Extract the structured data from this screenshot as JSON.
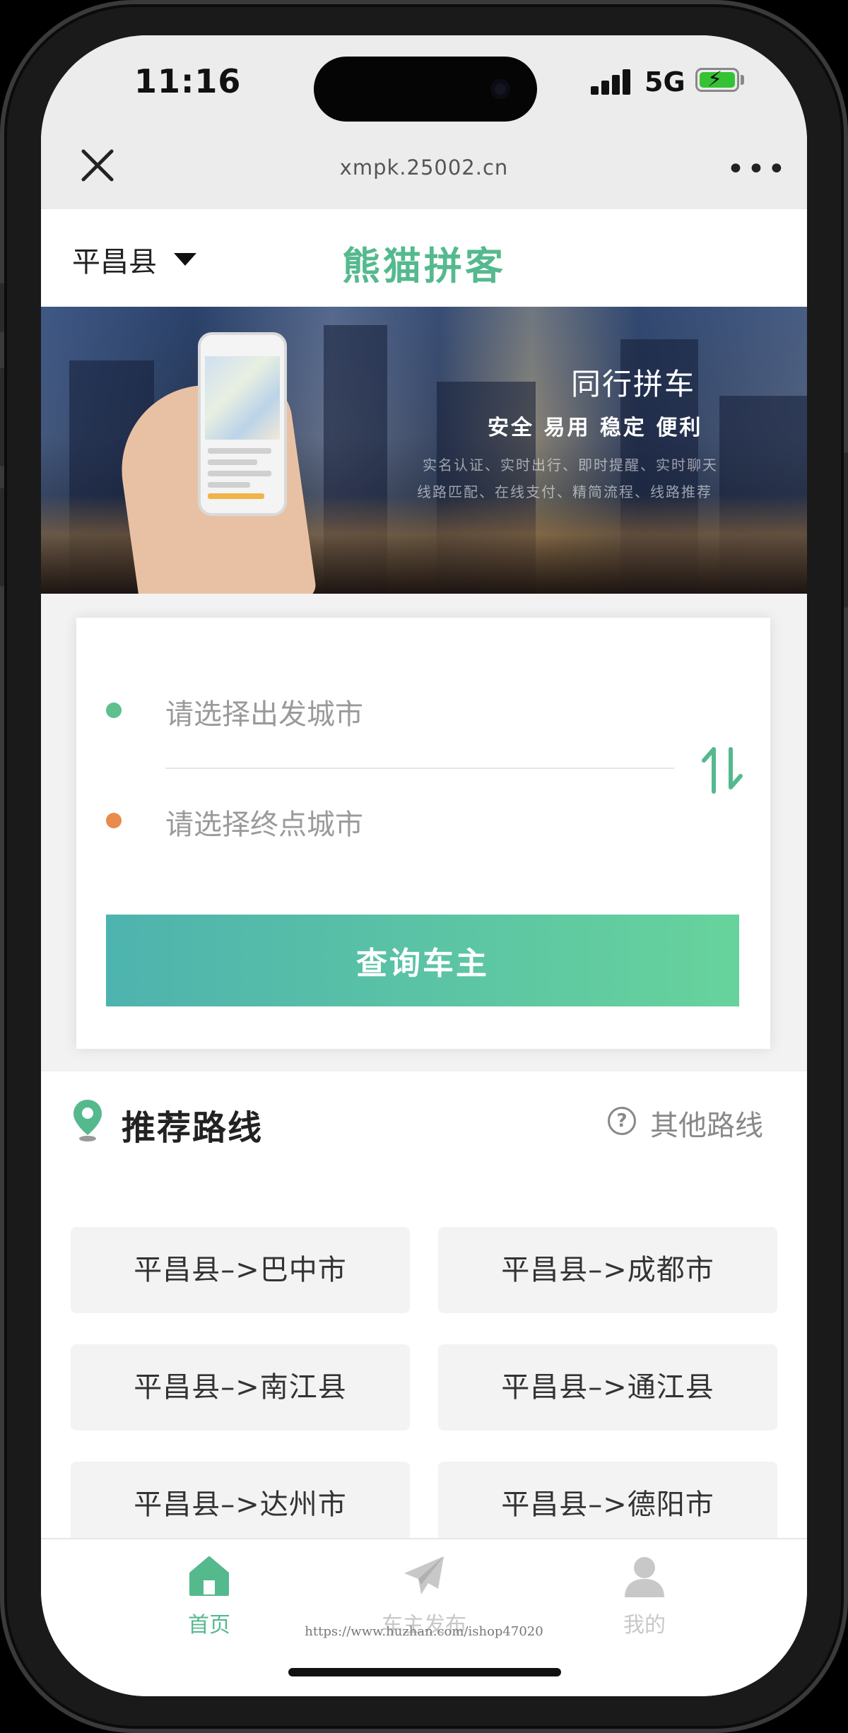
{
  "status_bar": {
    "time": "11:16",
    "network": "5G"
  },
  "browser": {
    "url": "xmpk.25002.cn",
    "more": "•••"
  },
  "header": {
    "city": "平昌县",
    "title": "熊猫拼客"
  },
  "banner": {
    "title": "同行拼车",
    "subtitle": "安全 易用 稳定 便利",
    "line1": "实名认证、实时出行、即时提醒、实时聊天",
    "line2": "线路匹配、在线支付、精简流程、线路推荐"
  },
  "search": {
    "from_placeholder": "请选择出发城市",
    "to_placeholder": "请选择终点城市",
    "query_button": "查询车主"
  },
  "routes": {
    "title": "推荐路线",
    "other": "其他路线",
    "items": [
      "平昌县–>巴中市",
      "平昌县–>成都市",
      "平昌县–>南江县",
      "平昌县–>通江县",
      "平昌县–>达州市",
      "平昌县–>德阳市"
    ]
  },
  "tabbar": {
    "items": [
      {
        "label": "首页",
        "icon": "home-icon",
        "active": true
      },
      {
        "label": "车主发布",
        "icon": "paper-plane-icon",
        "active": false
      },
      {
        "label": "我的",
        "icon": "user-icon",
        "active": false
      }
    ]
  },
  "watermark": "https://www.huzhan.com/ishop47020",
  "colors": {
    "brand": "#55b98e",
    "origin_dot": "#5ebf8f",
    "dest_dot": "#e88b4d",
    "inactive": "#c8c8c8"
  }
}
